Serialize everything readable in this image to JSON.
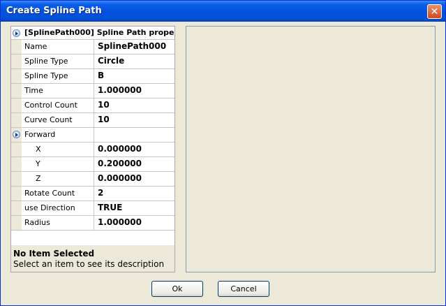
{
  "window": {
    "title": "Create Spline Path",
    "close_glyph": "✕"
  },
  "property_grid": {
    "header": "[SplinePath000] Spline Path prope",
    "rows": [
      {
        "name": "Name",
        "value": "SplinePath000"
      },
      {
        "name": "Spline Type",
        "value": "Circle"
      },
      {
        "name": "Spline Type",
        "value": "B"
      },
      {
        "name": "Time",
        "value": "1.000000"
      },
      {
        "name": "Control Count",
        "value": "10"
      },
      {
        "name": "Curve Count",
        "value": "10"
      },
      {
        "name": "Forward",
        "value": ""
      },
      {
        "name": "X",
        "value": "0.000000"
      },
      {
        "name": "Y",
        "value": "0.200000"
      },
      {
        "name": "Z",
        "value": "0.000000"
      },
      {
        "name": "Rotate Count",
        "value": "2"
      },
      {
        "name": "use Direction",
        "value": "TRUE"
      },
      {
        "name": "Radius",
        "value": "1.000000"
      }
    ]
  },
  "description": {
    "title": "No Item Selected",
    "text": "Select an item to see its description"
  },
  "buttons": {
    "ok": "Ok",
    "cancel": "Cancel"
  }
}
